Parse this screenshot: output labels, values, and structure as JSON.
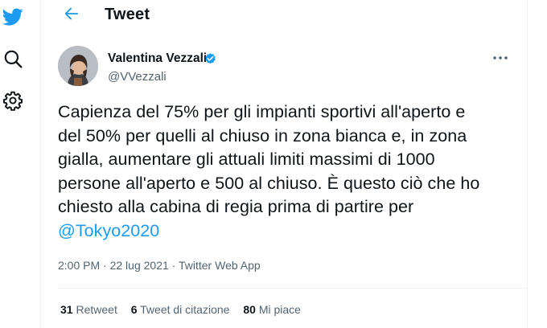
{
  "app": {
    "icons": {
      "logo": "twitter-bird-icon",
      "search": "search-icon",
      "settings": "gear-icon",
      "back": "arrow-left-icon",
      "more": "more-dots-icon",
      "verified": "verified-badge-icon"
    },
    "colors": {
      "accent": "#1d9bf0",
      "text": "#0f1419",
      "secondary": "#536471",
      "divider": "#eff3f4"
    }
  },
  "header": {
    "title": "Tweet"
  },
  "tweet": {
    "author": {
      "name": "Valentina Vezzali",
      "handle": "@VVezzali",
      "verified": true
    },
    "text_lines": [
      "Capienza del 75% per gli impianti sportivi all'aperto e",
      "del 50% per quelli al chiuso in zona bianca e, in zona",
      "gialla, aumentare gli attuali limiti massimi di 1000",
      "persone all'aperto e 500 al chiuso. È questo ciò che ho",
      "chiesto alla cabina di regia prima di partire per"
    ],
    "mention": "@Tokyo2020",
    "meta": {
      "time": "2:00 PM",
      "date": "22 lug 2021",
      "source": "Twitter Web App",
      "separator": " · "
    },
    "stats": {
      "retweets": {
        "count": "31",
        "label": "Retweet"
      },
      "quotes": {
        "count": "6",
        "label": "Tweet di citazione"
      },
      "likes": {
        "count": "80",
        "label": "Mi piace"
      }
    }
  }
}
